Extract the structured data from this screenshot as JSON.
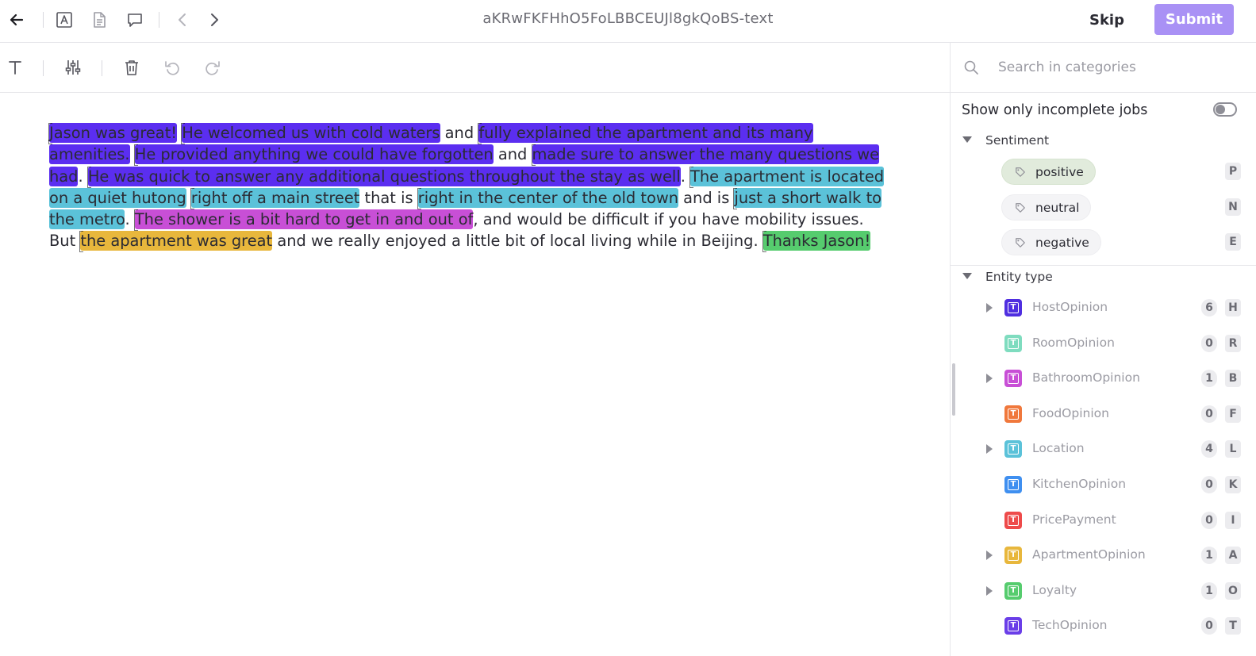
{
  "header": {
    "title": "aKRwFKFHhO5FoLBBCEUJl8gkQoBS-text",
    "skip_label": "Skip",
    "submit_label": "Submit",
    "icons": [
      "back-arrow-icon",
      "text-box-icon",
      "document-icon",
      "comment-icon",
      "chevron-left-icon",
      "chevron-right-icon"
    ]
  },
  "toolbar": {
    "icons": [
      "text-tool-icon",
      "sliders-icon",
      "trash-icon",
      "undo-icon",
      "redo-icon"
    ]
  },
  "document": {
    "segments": [
      {
        "text": "Jason was great!",
        "color": "#5b2ef0"
      },
      {
        "text": " ",
        "color": null
      },
      {
        "text": "He welcomed us with cold waters",
        "color": "#5b2ef0"
      },
      {
        "text": " and ",
        "color": null
      },
      {
        "text": "fully explained the apartment and its many amenities.",
        "color": "#5b2ef0"
      },
      {
        "text": " ",
        "color": null
      },
      {
        "text": "He provided anything we could have forgotten",
        "color": "#5b2ef0"
      },
      {
        "text": " and ",
        "color": null
      },
      {
        "text": "made sure to answer the many questions we had",
        "color": "#5b2ef0"
      },
      {
        "text": ". ",
        "color": null
      },
      {
        "text": "He was quick to answer any additional questions throughout the stay as well",
        "color": "#5b2ef0"
      },
      {
        "text": ". ",
        "color": null
      },
      {
        "text": "The apartment is located on a quiet hutong",
        "color": "#5bc2d9"
      },
      {
        "text": " ",
        "color": null
      },
      {
        "text": "right off a main street",
        "color": "#5bc2d9"
      },
      {
        "text": " that is ",
        "color": null
      },
      {
        "text": "right in the center of the old town",
        "color": "#5bc2d9"
      },
      {
        "text": " and is ",
        "color": null
      },
      {
        "text": "just a short walk to the metro",
        "color": "#5bc2d9"
      },
      {
        "text": ". ",
        "color": null
      },
      {
        "text": "The shower is a bit hard to get in and out of",
        "color": "#c84fd6"
      },
      {
        "text": ", and would be difficult if you have mobility issues. But ",
        "color": null
      },
      {
        "text": "the apartment was great",
        "color": "#e8b73c"
      },
      {
        "text": " and we really enjoyed a little bit of local living while in Beijing. ",
        "color": null
      },
      {
        "text": "Thanks Jason!",
        "color": "#56cc6e"
      }
    ]
  },
  "panel": {
    "search_placeholder": "Search in categories",
    "toggle_label": "Show only incomplete jobs",
    "toggle_on": false,
    "sentiment": {
      "title": "Sentiment",
      "items": [
        {
          "label": "positive",
          "key": "P",
          "active": true
        },
        {
          "label": "neutral",
          "key": "N",
          "active": false
        },
        {
          "label": "negative",
          "key": "E",
          "active": false
        }
      ]
    },
    "entity_type": {
      "title": "Entity type",
      "items": [
        {
          "name": "HostOpinion",
          "count": "6",
          "key": "H",
          "color": "#4f2ee0",
          "expandable": true
        },
        {
          "name": "RoomOpinion",
          "count": "0",
          "key": "R",
          "color": "#7fdcbf",
          "expandable": false
        },
        {
          "name": "BathroomOpinion",
          "count": "1",
          "key": "B",
          "color": "#c84fd6",
          "expandable": true
        },
        {
          "name": "FoodOpinion",
          "count": "0",
          "key": "F",
          "color": "#f0783c",
          "expandable": false
        },
        {
          "name": "Location",
          "count": "4",
          "key": "L",
          "color": "#5bc2d9",
          "expandable": true
        },
        {
          "name": "KitchenOpinion",
          "count": "0",
          "key": "K",
          "color": "#3f8ff0",
          "expandable": false
        },
        {
          "name": "PricePayment",
          "count": "0",
          "key": "I",
          "color": "#ee4a4a",
          "expandable": false
        },
        {
          "name": "ApartmentOpinion",
          "count": "1",
          "key": "A",
          "color": "#e8b73c",
          "expandable": true
        },
        {
          "name": "Loyalty",
          "count": "1",
          "key": "O",
          "color": "#56cc6e",
          "expandable": true
        },
        {
          "name": "TechOpinion",
          "count": "0",
          "key": "T",
          "color": "#6a3ee8",
          "expandable": false
        }
      ]
    }
  }
}
